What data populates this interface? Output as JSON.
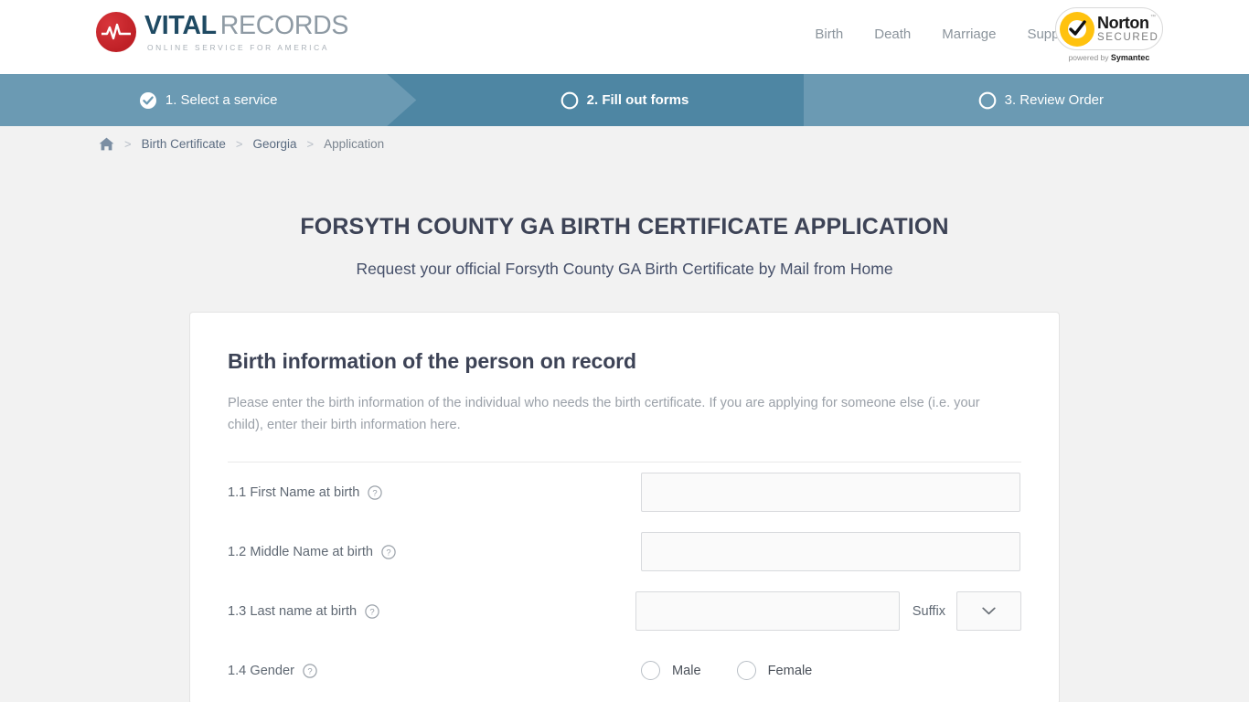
{
  "header": {
    "logo": {
      "icon": "heartbeat-circle-icon",
      "title_primary": "VITAL",
      "title_secondary": "RECORDS",
      "tagline": "ONLINE SERVICE FOR AMERICA"
    },
    "nav": [
      {
        "label": "Birth"
      },
      {
        "label": "Death"
      },
      {
        "label": "Marriage"
      },
      {
        "label": "Support"
      }
    ],
    "norton": {
      "icon": "norton-check-icon",
      "line1": "Norton",
      "line2": "SECURED",
      "trademark": "™",
      "footer_prefix": "powered by",
      "footer_brand": "Symantec"
    }
  },
  "steps": [
    {
      "label": "1. Select a service",
      "state": "completed",
      "icon": "check-circle-icon"
    },
    {
      "label": "2. Fill out forms",
      "state": "active",
      "icon": "circle-icon"
    },
    {
      "label": "3. Review Order",
      "state": "upcoming",
      "icon": "circle-icon"
    }
  ],
  "breadcrumb": {
    "home_icon": "home-icon",
    "separator": ">",
    "items": [
      {
        "label": "Birth Certificate",
        "current": false
      },
      {
        "label": "Georgia",
        "current": false
      },
      {
        "label": "Application",
        "current": true
      }
    ]
  },
  "page": {
    "title": "FORSYTH COUNTY GA BIRTH CERTIFICATE APPLICATION",
    "subtitle": "Request your official Forsyth County GA Birth Certificate by Mail from Home"
  },
  "form": {
    "heading": "Birth information of the person on record",
    "description": "Please enter the birth information of the individual who needs the birth certificate. If you are applying for someone else (i.e. your child), enter their birth information here.",
    "fields": [
      {
        "label": "1.1 First Name at birth",
        "help_icon": "question-circle-icon",
        "value": "",
        "placeholder": ""
      },
      {
        "label": "1.2 Middle Name at birth",
        "help_icon": "question-circle-icon",
        "value": "",
        "placeholder": ""
      },
      {
        "label": "1.3 Last name at birth",
        "help_icon": "question-circle-icon",
        "value": "",
        "placeholder": ""
      },
      {
        "label": "1.4 Gender",
        "help_icon": "question-circle-icon",
        "value": "",
        "placeholder": ""
      }
    ],
    "suffix": {
      "label": "Suffix",
      "selected": "",
      "chevron_icon": "chevron-down-icon"
    },
    "gender_options": [
      {
        "label": "Male",
        "selected": false
      },
      {
        "label": "Female",
        "selected": false
      }
    ]
  },
  "colors": {
    "page_bg": "#f2f2f2",
    "step_inactive": "#6b9ab3",
    "step_active": "#4e86a3",
    "logo_red": "#c9252c",
    "logo_navy": "#1f4a63",
    "norton_yellow": "#ffc20e",
    "title_navy": "#3d4356"
  }
}
